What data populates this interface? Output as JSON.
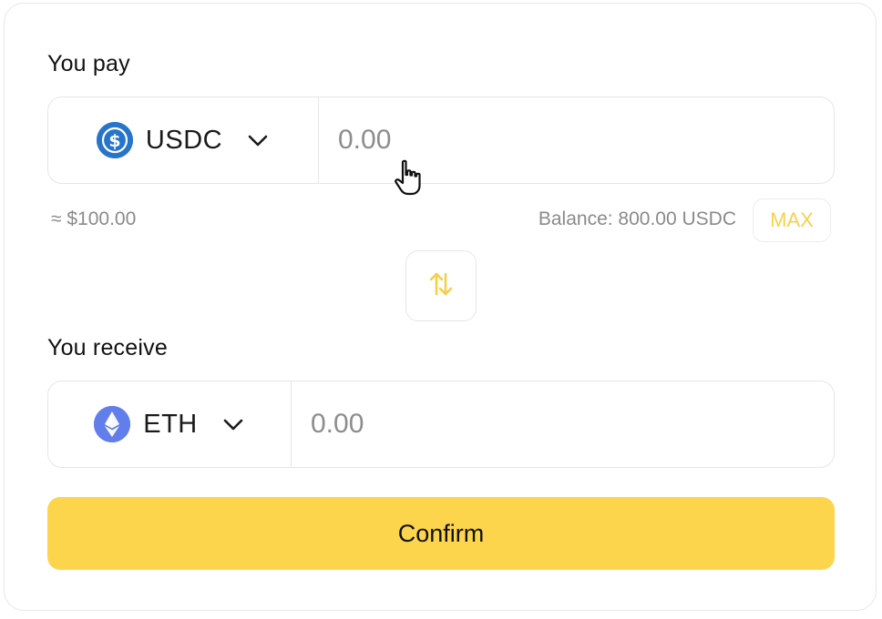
{
  "pay": {
    "label": "You pay",
    "token": {
      "symbol": "USDC",
      "icon": "usdc-icon",
      "color": "#2775ca"
    },
    "amount_placeholder": "0.00",
    "usd_estimate": "≈ $100.00",
    "balance": "Balance: 800.00 USDC",
    "max_label": "MAX"
  },
  "receive": {
    "label": "You receive",
    "token": {
      "symbol": "ETH",
      "icon": "eth-icon",
      "color": "#627eea"
    },
    "amount_placeholder": "0.00"
  },
  "flip": {
    "icon": "swap-arrows-icon"
  },
  "confirm": {
    "label": "Confirm"
  },
  "colors": {
    "accent": "#fdd54d",
    "max_text": "#f5d24d",
    "border": "#e6e6e6",
    "muted_text": "#8a8a8a"
  }
}
